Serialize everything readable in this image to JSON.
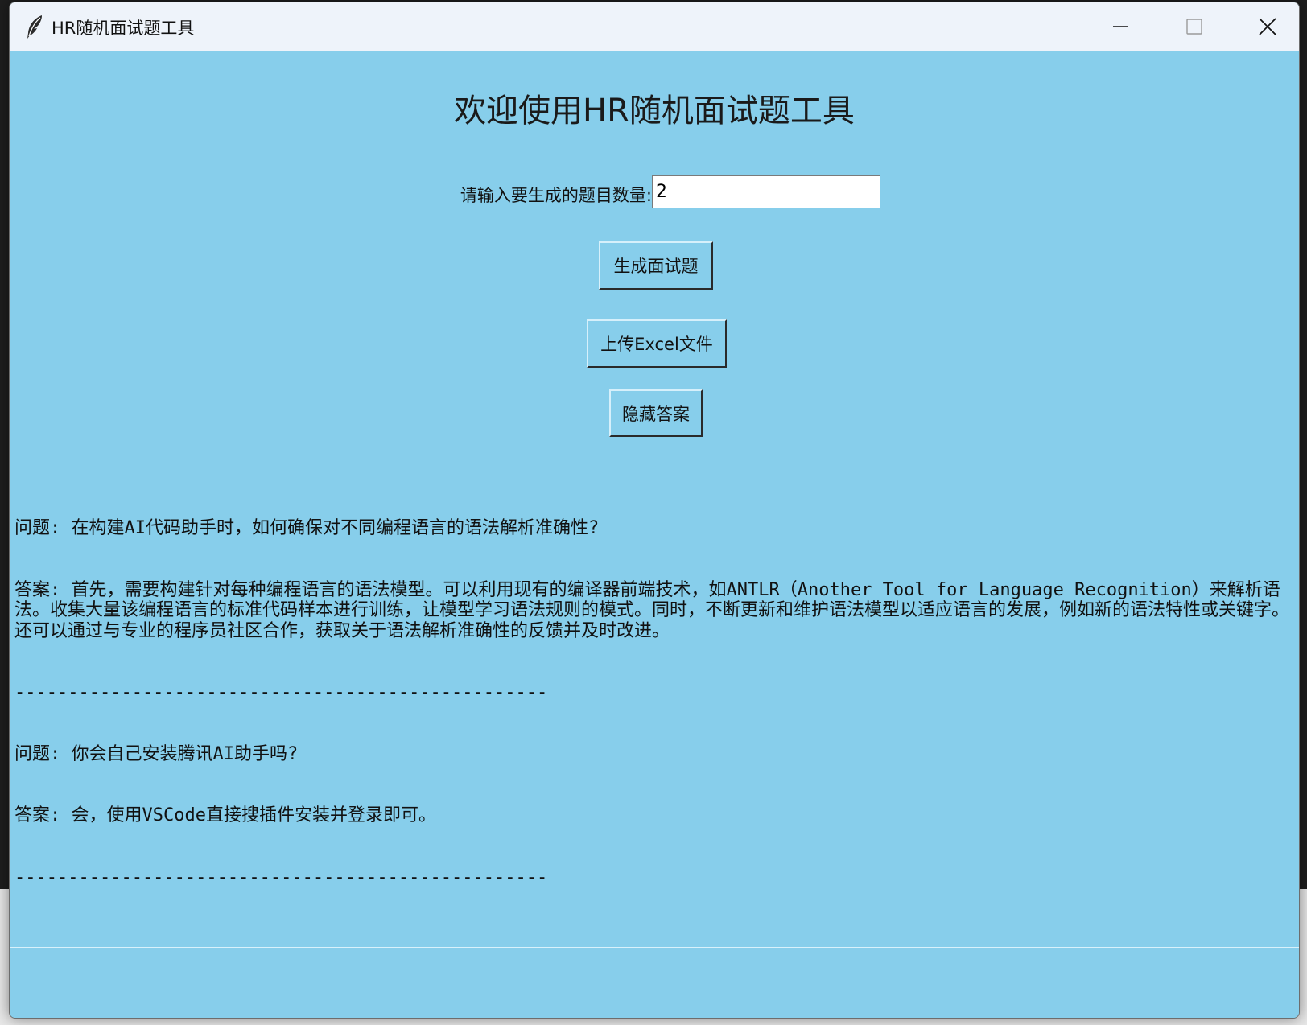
{
  "window": {
    "title": "HR随机面试题工具",
    "app_icon": "feather-icon",
    "controls": [
      "minimize-icon",
      "maximize-icon",
      "close-icon"
    ]
  },
  "main": {
    "heading": "欢迎使用HR随机面试题工具",
    "count_label": "请输入要生成的题目数量:",
    "count_value": "2",
    "generate_button": "生成面试题",
    "upload_button": "上传Excel文件",
    "hide_answer_button": "隐藏答案"
  },
  "output": {
    "entries": [
      {
        "question": "问题: 在构建AI代码助手时，如何确保对不同编程语言的语法解析准确性?",
        "answer": "答案: 首先，需要构建针对每种编程语言的语法模型。可以利用现有的编译器前端技术，如ANTLR（Another Tool for Language Recognition）来解析语法。收集大量该编程语言的标准代码样本进行训练，让模型学习语法规则的模式。同时，不断更新和维护语法模型以适应语言的发展，例如新的语法特性或关键字。还可以通过与专业的程序员社区合作，获取关于语法解析准确性的反馈并及时改进。",
        "separator": "--------------------------------------------------"
      },
      {
        "question": "问题: 你会自己安装腾讯AI助手吗?",
        "answer": "答案: 会，使用VSCode直接搜插件安装并登录即可。",
        "separator": "--------------------------------------------------"
      }
    ]
  },
  "colors": {
    "background": "#87ceeb",
    "titlebar": "#eef3fa",
    "input_bg": "#ffffff"
  }
}
